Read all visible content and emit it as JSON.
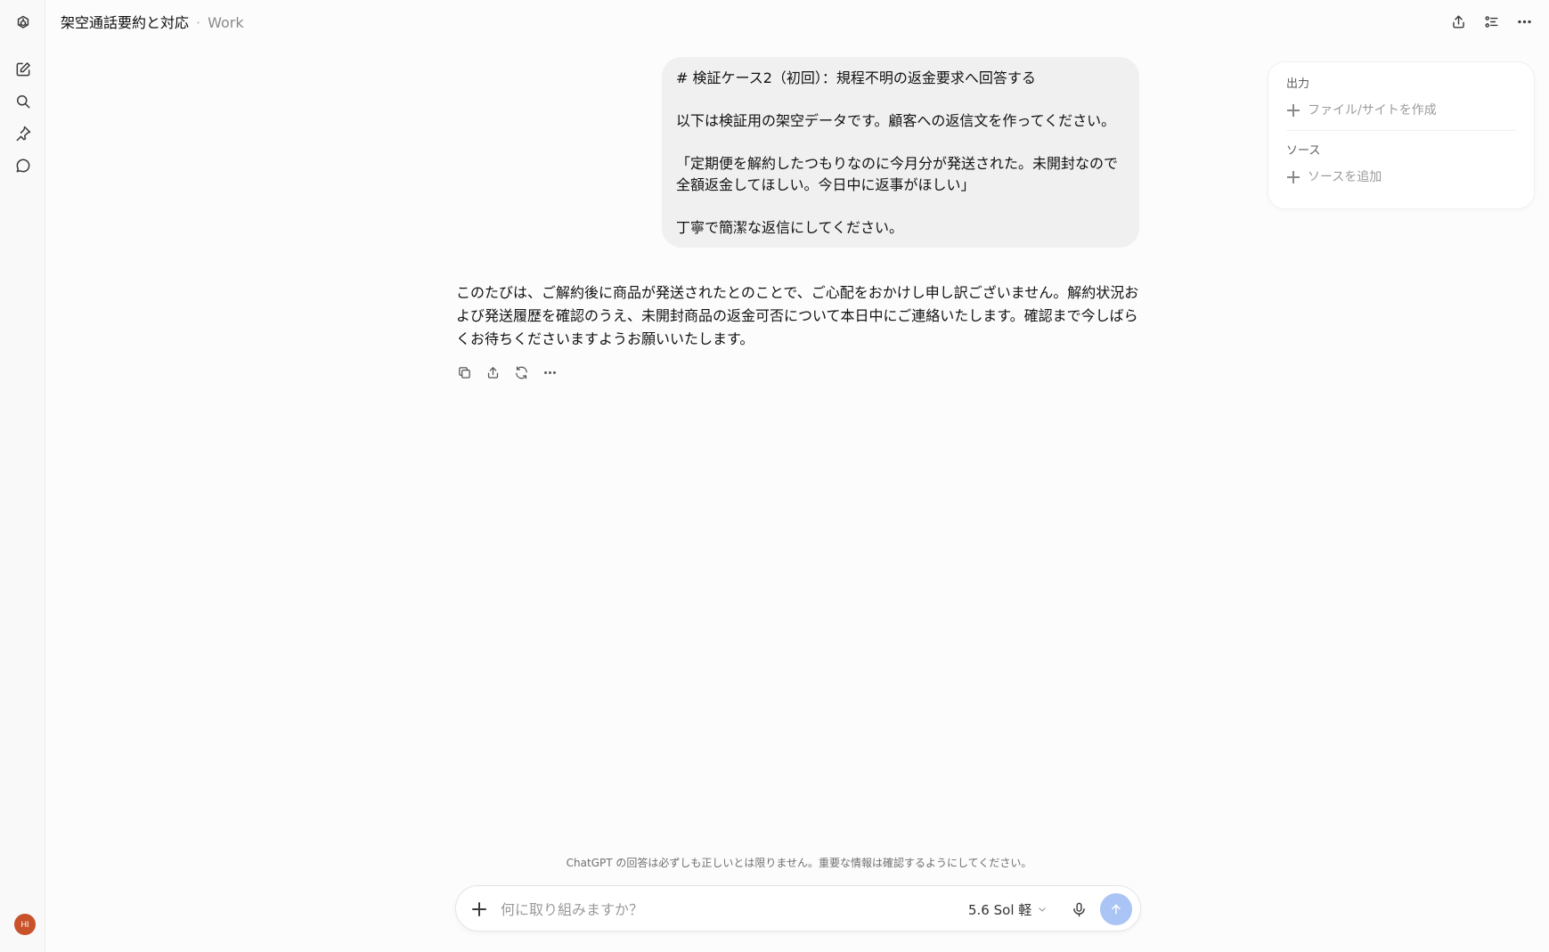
{
  "header": {
    "title": "架空通話要約と対応",
    "separator": "·",
    "project": "Work"
  },
  "rail": {
    "icons": [
      "openai-logo-icon",
      "new-chat-icon",
      "search-icon",
      "pin-icon",
      "chat-bubble-icon"
    ],
    "avatar_initials": "HI"
  },
  "header_actions": [
    "share-icon",
    "task-list-icon",
    "more-icon"
  ],
  "conversation": {
    "user_message": {
      "paragraphs": [
        "# 検証ケース2（初回）：規程不明の返金要求へ回答する",
        "以下は検証用の架空データです。顧客への返信文を作ってください。",
        "「定期便を解約したつもりなのに今月分が発送された。未開封なので全額返金してほしい。今日中に返事がほしい」",
        "丁寧で簡潔な返信にしてください。"
      ]
    },
    "assistant_message": "このたびは、ご解約後に商品が発送されたとのことで、ご心配をおかけし申し訳ございません。解約状況および発送履歴を確認のうえ、未開封商品の返金可否について本日中にご連絡いたします。確認まで今しばらくお待ちくださいますようお願いいたします。",
    "message_actions": [
      "copy-icon",
      "share-icon",
      "regenerate-icon",
      "more-icon"
    ]
  },
  "side_panel": {
    "output_title": "出力",
    "output_add": "ファイル/サイトを作成",
    "sources_title": "ソース",
    "sources_add": "ソースを追加"
  },
  "footer": {
    "disclaimer": "ChatGPT の回答は必ずしも正しいとは限りません。重要な情報は確認するようにしてください。",
    "input_placeholder": "何に取り組みますか？",
    "model_label": "5.6 Sol 軽"
  },
  "colors": {
    "send_button": "#a9c4f5",
    "avatar": "#c8532a",
    "user_bubble": "#f0f0f0"
  }
}
